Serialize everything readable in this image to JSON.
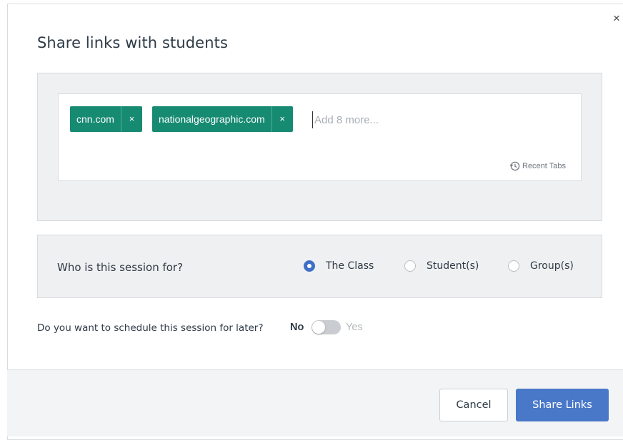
{
  "dialog": {
    "title": "Share links with students",
    "close_label": "×"
  },
  "links": {
    "chips": [
      {
        "label": "cnn.com",
        "remove_label": "×"
      },
      {
        "label": "nationalgeographic.com",
        "remove_label": "×"
      }
    ],
    "input_placeholder": "Add 8 more...",
    "input_value": "",
    "recent_tabs_label": "Recent Tabs"
  },
  "session": {
    "question": "Who is this session for?",
    "options": [
      {
        "label": "The Class",
        "selected": true
      },
      {
        "label": "Student(s)",
        "selected": false
      },
      {
        "label": "Group(s)",
        "selected": false
      }
    ]
  },
  "schedule": {
    "question": "Do you want to schedule this session for later?",
    "no_label": "No",
    "yes_label": "Yes",
    "enabled": false
  },
  "footer": {
    "cancel_label": "Cancel",
    "share_label": "Share Links"
  },
  "colors": {
    "chip": "#178a72",
    "primary": "#4a78c9",
    "radio_selected": "#3f6fc6",
    "panel_bg": "#eff0f1"
  },
  "icons": {
    "close": "close-icon",
    "chip_remove": "remove-icon",
    "recent_tabs": "history-icon"
  }
}
